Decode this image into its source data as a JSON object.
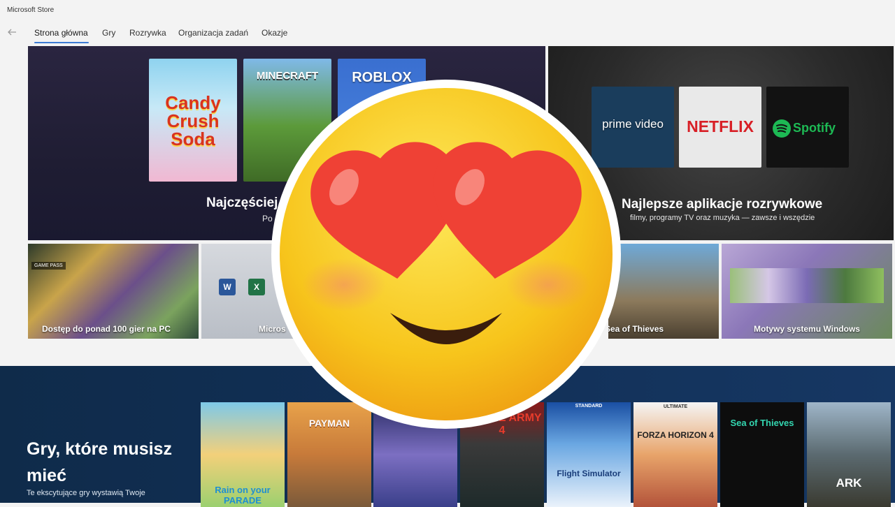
{
  "window": {
    "title": "Microsoft Store"
  },
  "nav": {
    "tabs": [
      {
        "label": "Strona główna",
        "active": true
      },
      {
        "label": "Gry"
      },
      {
        "label": "Rozrywka"
      },
      {
        "label": "Organizacja zadań"
      },
      {
        "label": "Okazje"
      }
    ]
  },
  "hero_left": {
    "title": "Najczęściej",
    "subtitle": "Po",
    "tiles": [
      "Candy Crush Soda",
      "MINECRAFT",
      "ROBLOX"
    ]
  },
  "hero_right": {
    "title": "Najlepsze aplikacje rozrywkowe",
    "subtitle": "filmy, programy TV oraz muzyka — zawsze i wszędzie",
    "tiles": [
      "prime video",
      "NETFLIX",
      "Spotify"
    ]
  },
  "row": {
    "tiles": [
      {
        "label": "Dostęp do ponad 100 gier na PC",
        "badge": "GAME PASS"
      },
      {
        "label": "Micros"
      },
      {
        "label": "Sea of Thieves"
      },
      {
        "label": "Motywy systemu Windows"
      }
    ]
  },
  "band": {
    "title": "Gry, które musisz mieć",
    "subtitle": "Te ekscytujące gry wystawią Twoje",
    "games": [
      {
        "label": "Rain on your PARADE"
      },
      {
        "label": "PAYMAN"
      },
      {
        "label": ""
      },
      {
        "label": "ZOMBIE ARMY 4"
      },
      {
        "label": "Flight Simulator",
        "top": "STANDARD"
      },
      {
        "label": "FORZA HORIZON 4",
        "top": "ULTIMATE"
      },
      {
        "label": "Sea of Thieves"
      },
      {
        "label": "ARK"
      }
    ]
  },
  "colors": {
    "accent": "#3c7bd4",
    "emoji_face": "#f7c51c",
    "emoji_heart": "#ef4135"
  },
  "icons": [
    "back-arrow-icon",
    "heart-eyes-emoji",
    "word-icon",
    "excel-icon",
    "spotify-icon"
  ]
}
